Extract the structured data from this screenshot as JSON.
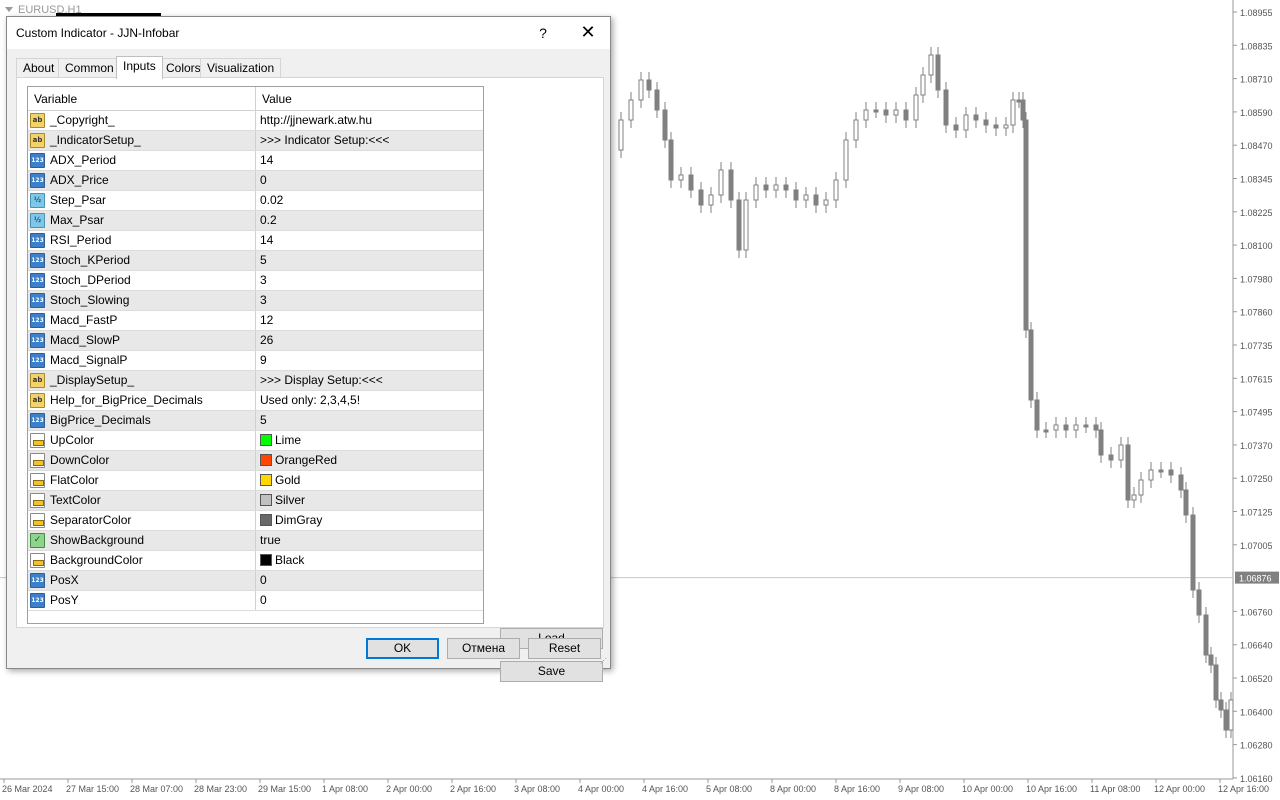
{
  "chart": {
    "symbol_label": "EURUSD,H1",
    "price_labels": [
      "1.08955",
      "1.08835",
      "1.08710",
      "1.08590",
      "1.08470",
      "1.08345",
      "1.08225",
      "1.08100",
      "1.07980",
      "1.07860",
      "1.07735",
      "1.07615",
      "1.07495",
      "1.07370",
      "1.07250",
      "1.07125",
      "1.07005",
      "1.06876",
      "1.06760",
      "1.06640",
      "1.06520",
      "1.06400",
      "1.06280",
      "1.06160"
    ],
    "current_price": "1.06876",
    "time_labels": [
      "26 Mar 2024",
      "27 Mar 15:00",
      "28 Mar 07:00",
      "28 Mar 23:00",
      "29 Mar 15:00",
      "1 Apr 08:00",
      "2 Apr 00:00",
      "2 Apr 16:00",
      "3 Apr 08:00",
      "4 Apr 00:00",
      "4 Apr 16:00",
      "5 Apr 08:00",
      "8 Apr 00:00",
      "8 Apr 16:00",
      "9 Apr 08:00",
      "10 Apr 00:00",
      "10 Apr 16:00",
      "11 Apr 08:00",
      "12 Apr 00:00",
      "12 Apr 16:00"
    ],
    "colors": {
      "candle": "#808080",
      "current_price_bg": "#808080",
      "axis_text": "#555555"
    }
  },
  "dialog": {
    "title": "Custom Indicator - JJN-Infobar",
    "help_label": "?",
    "close_label": "✕",
    "tabs": [
      "About",
      "Common",
      "Inputs",
      "Colors",
      "Visualization"
    ],
    "active_tab": "Inputs",
    "grid": {
      "header_variable": "Variable",
      "header_value": "Value",
      "rows": [
        {
          "type": "str",
          "icon": "ab",
          "name": "_Copyright_",
          "value": "http://jjnewark.atw.hu"
        },
        {
          "type": "str",
          "icon": "ab",
          "name": "_IndicatorSetup_",
          "value": ">>> Indicator Setup:<<<"
        },
        {
          "type": "int",
          "icon": "123",
          "name": "ADX_Period",
          "value": "14"
        },
        {
          "type": "int",
          "icon": "123",
          "name": "ADX_Price",
          "value": "0"
        },
        {
          "type": "dbl",
          "icon": "½",
          "name": "Step_Psar",
          "value": "0.02"
        },
        {
          "type": "dbl",
          "icon": "½",
          "name": "Max_Psar",
          "value": "0.2"
        },
        {
          "type": "int",
          "icon": "123",
          "name": "RSI_Period",
          "value": "14"
        },
        {
          "type": "int",
          "icon": "123",
          "name": "Stoch_KPeriod",
          "value": "5"
        },
        {
          "type": "int",
          "icon": "123",
          "name": "Stoch_DPeriod",
          "value": "3"
        },
        {
          "type": "int",
          "icon": "123",
          "name": "Stoch_Slowing",
          "value": "3"
        },
        {
          "type": "int",
          "icon": "123",
          "name": "Macd_FastP",
          "value": "12"
        },
        {
          "type": "int",
          "icon": "123",
          "name": "Macd_SlowP",
          "value": "26"
        },
        {
          "type": "int",
          "icon": "123",
          "name": "Macd_SignalP",
          "value": "9"
        },
        {
          "type": "str",
          "icon": "ab",
          "name": "_DisplaySetup_",
          "value": ">>> Display Setup:<<<"
        },
        {
          "type": "str",
          "icon": "ab",
          "name": "Help_for_BigPrice_Decimals",
          "value": "Used only: 2,3,4,5!"
        },
        {
          "type": "int",
          "icon": "123",
          "name": "BigPrice_Decimals",
          "value": "5"
        },
        {
          "type": "col",
          "icon": "",
          "name": "UpColor",
          "value": "Lime",
          "swatch": "#00ff00"
        },
        {
          "type": "col",
          "icon": "",
          "name": "DownColor",
          "value": "OrangeRed",
          "swatch": "#ff4500"
        },
        {
          "type": "col",
          "icon": "",
          "name": "FlatColor",
          "value": "Gold",
          "swatch": "#ffd700"
        },
        {
          "type": "col",
          "icon": "",
          "name": "TextColor",
          "value": "Silver",
          "swatch": "#c0c0c0"
        },
        {
          "type": "col",
          "icon": "",
          "name": "SeparatorColor",
          "value": "DimGray",
          "swatch": "#696969"
        },
        {
          "type": "bool",
          "icon": "",
          "name": "ShowBackground",
          "value": "true"
        },
        {
          "type": "col",
          "icon": "",
          "name": "BackgroundColor",
          "value": "Black",
          "swatch": "#000000"
        },
        {
          "type": "int",
          "icon": "123",
          "name": "PosX",
          "value": "0"
        },
        {
          "type": "int",
          "icon": "123",
          "name": "PosY",
          "value": "0"
        }
      ]
    },
    "buttons": {
      "load": "Load",
      "save": "Save",
      "ok": "OK",
      "cancel": "Отмена",
      "reset": "Reset"
    }
  }
}
